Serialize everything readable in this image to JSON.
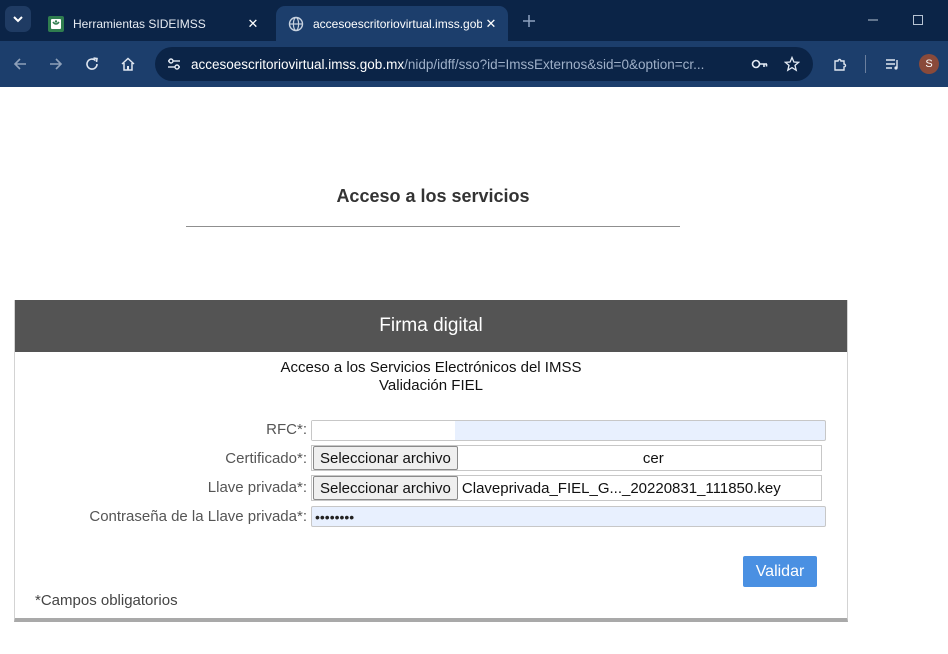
{
  "browser": {
    "tabs": [
      {
        "title": "Herramientas SIDEIMSS",
        "favicon": "imss-logo-icon",
        "active": false
      },
      {
        "title": "accesoescritoriovirtual.imss.gob.mx",
        "favicon": "globe-icon",
        "active": true
      }
    ],
    "url_host": "accesoescritoriovirtual.imss.gob.mx",
    "url_path": "/nidp/idff/sso?id=ImssExternos&sid=0&option=cr...",
    "profile_initial": "S"
  },
  "page": {
    "heading": "Acceso a los servicios"
  },
  "panel": {
    "title": "Firma digital",
    "subtitle_line1": "Acceso a los Servicios Electrónicos del IMSS",
    "subtitle_line2": "Validación FIEL"
  },
  "form": {
    "rfc_label": "RFC*:",
    "rfc_value": "",
    "certificado_label": "Certificado*:",
    "certificado_button": "Seleccionar archivo",
    "certificado_file": "cer",
    "llave_label": "Llave privada*:",
    "llave_button": "Seleccionar archivo",
    "llave_file": "Claveprivada_FIEL_G..._20220831_111850.key",
    "password_label": "Contraseña de la Llave privada*:",
    "password_value": "••••••••",
    "submit_label": "Validar",
    "required_note": "*Campos obligatorios"
  },
  "colors": {
    "chrome_dark": "#0b2447",
    "chrome_toolbar": "#1c3e6c",
    "panel_header": "#545454",
    "autofill_bg": "#e8f0fe",
    "button_blue": "#4a90e2"
  }
}
